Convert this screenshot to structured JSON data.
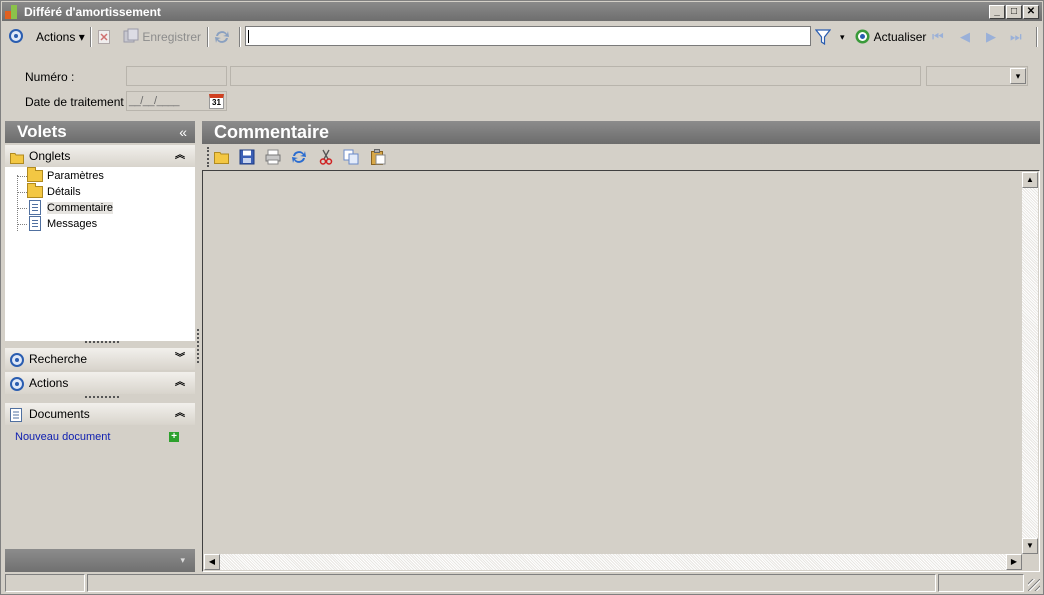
{
  "window": {
    "title": "Différé d'amortissement",
    "minimize": "_",
    "maximize": "□",
    "close": "✕"
  },
  "toolbar": {
    "actions_label": "Actions",
    "actions_arrow": "▾",
    "save_label": "Enregistrer",
    "search_value": "",
    "filter_arrow": "▾",
    "refresh_label": "Actualiser",
    "nav_first": "⏮",
    "nav_prev": "◀",
    "nav_next": "▶",
    "nav_last": "⏭"
  },
  "form": {
    "numero_label": "Numéro :",
    "numero_value": "",
    "description_value": "",
    "combo_value": "",
    "combo_arrow": "▾",
    "date_label": "Date de traitement :",
    "date_value": "__/__/____",
    "calendar_day": "31"
  },
  "sidebar": {
    "title": "Volets",
    "collapse": "«",
    "groups": {
      "onglets": {
        "label": "Onglets",
        "chevron": "︽"
      },
      "recherche": {
        "label": "Recherche",
        "chevron": "︾"
      },
      "actions": {
        "label": "Actions",
        "chevron": "︽"
      },
      "documents": {
        "label": "Documents",
        "chevron": "︽"
      }
    },
    "tree": [
      {
        "label": "Paramètres"
      },
      {
        "label": "Détails"
      },
      {
        "label": "Commentaire"
      },
      {
        "label": "Messages"
      }
    ],
    "new_document": "Nouveau document",
    "plus": "+",
    "footer_arrow": "▾"
  },
  "content": {
    "title": "Commentaire"
  },
  "scroll": {
    "up": "▲",
    "down": "▼",
    "left": "◀",
    "right": "▶"
  },
  "colors": {
    "accent": "#2a5db0",
    "link": "#1020b0",
    "header": "#7c7c7c"
  }
}
